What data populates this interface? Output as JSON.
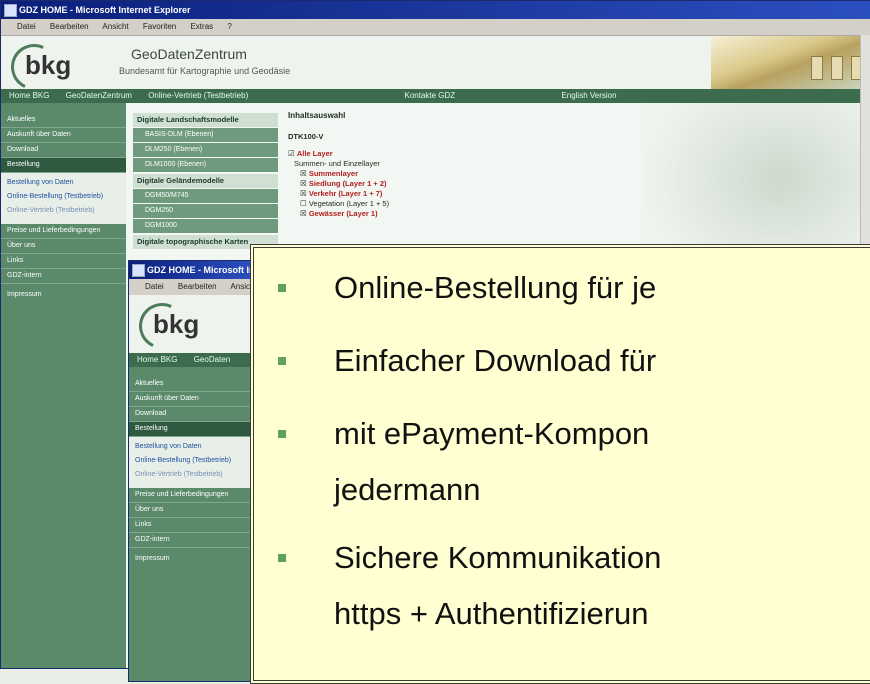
{
  "window1": {
    "title": "GDZ HOME - Microsoft Internet Explorer",
    "menu": [
      "Datei",
      "Bearbeiten",
      "Ansicht",
      "Favoriten",
      "Extras",
      "?"
    ],
    "logo_text": "bkg",
    "site_title": "GeoDatenZentrum",
    "site_subtitle": "Bundesamt für Kartographie und Geodäsie",
    "nav": [
      "Home BKG",
      "GeoDatenZentrum",
      "Online-Vertrieb (Testbetrieb)",
      "Kontakte GDZ",
      "English Version"
    ],
    "sidebar_items": [
      "Aktuelles",
      "Auskunft über Daten",
      "Download",
      "Bestellung"
    ],
    "sidebar_links": [
      "Bestellung von Daten",
      "Online-Bestellung (Testbetrieb)",
      "Online-Vertrieb (Testbetrieb)"
    ],
    "sidebar_items2": [
      "Preise und Lieferbedingungen",
      "Über uns",
      "Links",
      "GDZ-intern"
    ],
    "impressum": "Impressum",
    "col2_groups": [
      {
        "title": "Digitale Landschaftsmodelle",
        "items": [
          "BASIS-DLM (Ebenen)",
          "DLM250 (Ebenen)",
          "DLM1000 (Ebenen)"
        ]
      },
      {
        "title": "Digitale Geländemodelle",
        "items": [
          "DGM50/M745",
          "DGM250",
          "DGM1000"
        ]
      },
      {
        "title": "Digitale topographische Karten",
        "items": []
      }
    ],
    "col3": {
      "heading": "Inhaltsauswahl",
      "product": "DTK100-V",
      "rows": [
        "Alle Layer",
        "Summen- und Einzellayer",
        "Summenlayer",
        "Siedlung (Layer 1 + 2)",
        "Verkehr (Layer 1 + 7)",
        "Vegetation (Layer 1 + 5)",
        "Gewässer (Layer 1)"
      ]
    }
  },
  "window2": {
    "title": "GDZ HOME - Microsoft Internet",
    "menu": [
      "Datei",
      "Bearbeiten",
      "Ansicht"
    ],
    "logo_text": "bkg",
    "nav": [
      "Home BKG",
      "GeoDaten"
    ],
    "sidebar_items": [
      "Aktuelles",
      "Auskunft über Daten",
      "Download",
      "Bestellung"
    ],
    "sidebar_links": [
      "Bestellung von Daten",
      "Online-Bestellung (Testbetrieb)",
      "Online-Vertrieb (Testbetrieb)"
    ],
    "sidebar_items2": [
      "Preise und Lieferbedingungen",
      "Über uns",
      "Links",
      "GDZ-intern"
    ],
    "impressum": "Impressum"
  },
  "callout": {
    "bullets": [
      "Online-Bestellung für je",
      "Einfacher Download für",
      "mit ePayment-Kompon",
      "jedermann",
      "Sichere Kommunikation",
      "https + Authentifizierun"
    ]
  },
  "colors": {
    "accent_green": "#5a8a6a",
    "callout_bg": "#ffffd1",
    "bullet": "#5fa05f"
  }
}
